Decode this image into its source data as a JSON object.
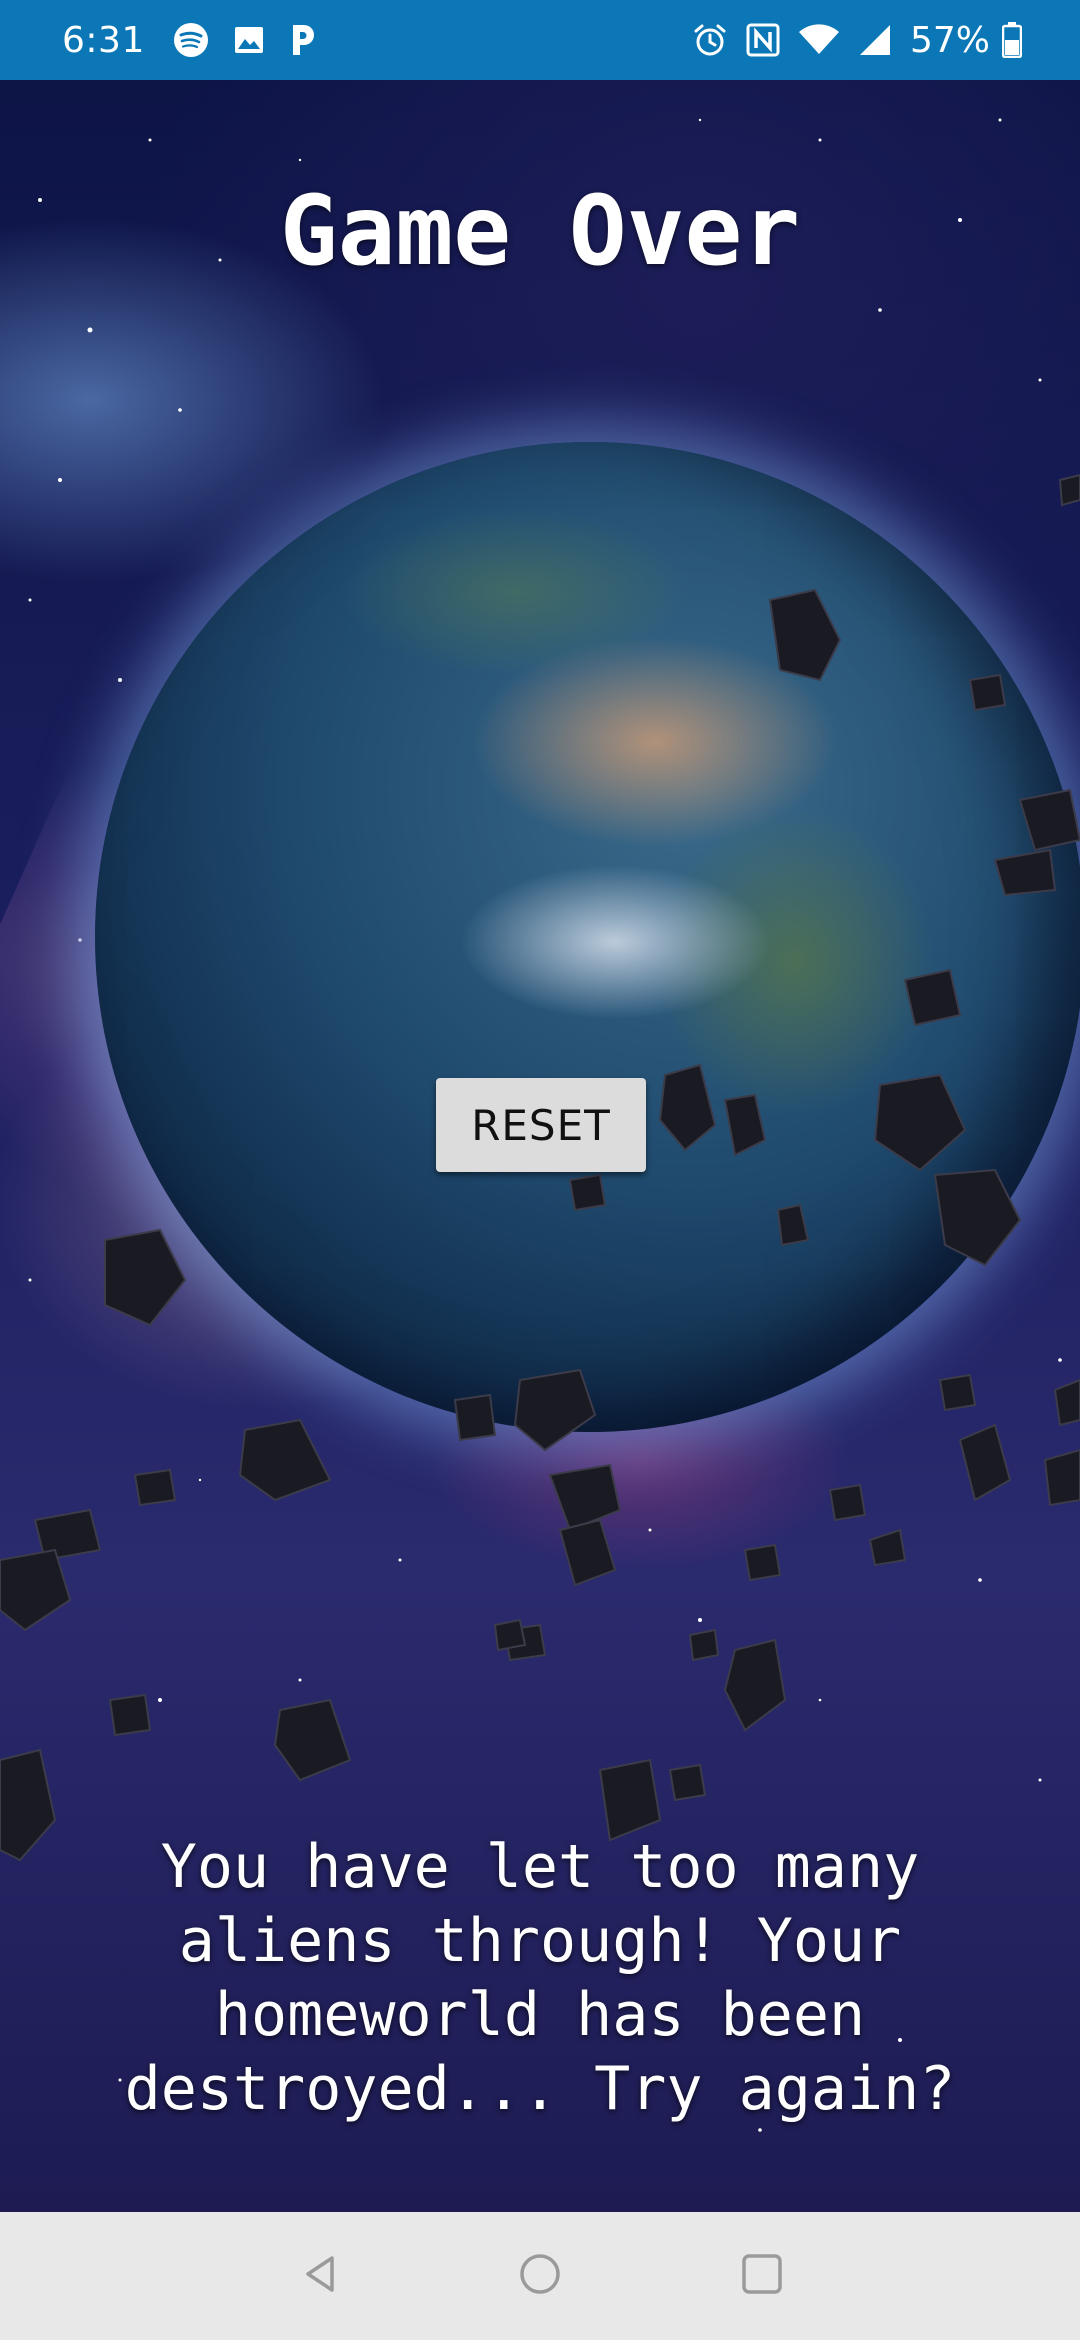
{
  "status_bar": {
    "time": "6:31",
    "left_icons": [
      "spotify-icon",
      "image-icon",
      "pandora-icon"
    ],
    "right_icons": [
      "alarm-icon",
      "nfc-icon",
      "wifi-icon",
      "signal-icon"
    ],
    "battery_percent": "57%",
    "background_color": "#0b77b6"
  },
  "game": {
    "title": "Game Over",
    "reset_label": "RESET",
    "message": "You have let too many aliens through! Your homeworld has been destroyed... Try again?"
  },
  "nav_bar": {
    "buttons": [
      "back-icon",
      "home-icon",
      "recents-icon"
    ],
    "background_color": "#e8e8e8"
  }
}
